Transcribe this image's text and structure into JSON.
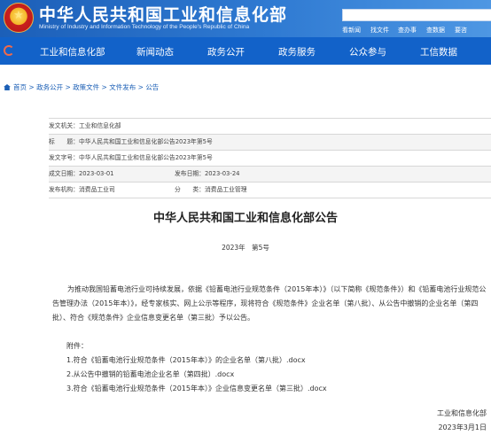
{
  "header": {
    "title": "中华人民共和国工业和信息化部",
    "subtitle": "Ministry of Industry and Information Technology of the People's Republic of China",
    "search_placeholder": "",
    "quick_links": [
      "看新闻",
      "找文件",
      "查办事",
      "查数据",
      "要咨"
    ]
  },
  "nav": {
    "items": [
      "工业和信息化部",
      "新闻动态",
      "政务公开",
      "政务服务",
      "公众参与",
      "工信数据"
    ]
  },
  "breadcrumb": {
    "items": [
      "首页",
      "政务公开",
      "政策文件",
      "文件发布",
      "公告"
    ],
    "separator": ">"
  },
  "meta": {
    "issuer_label": "发文机关：",
    "issuer": "工业和信息化部",
    "title_label": "标　　题：",
    "title": "中华人民共和国工业和信息化部公告2023年第5号",
    "doc_no_label": "发文字号：",
    "doc_no": "中华人民共和国工业和信息化部公告2023年第5号",
    "written_label": "成文日期：",
    "written_date": "2023-03-01",
    "published_label": "发布日期：",
    "published_date": "2023-03-24",
    "org_label": "发布机构：",
    "org": "消费品工业司",
    "category_label": "分　　类：",
    "category": "消费品工业管理"
  },
  "document": {
    "title": "中华人民共和国工业和信息化部公告",
    "number": "2023年　第5号",
    "paragraph": "为推动我国铅蓄电池行业可持续发展，依据《铅蓄电池行业规范条件（2015年本）》（以下简称《规范条件》）和《铅蓄电池行业规范公告管理办法（2015年本）》，经专家核实、网上公示等程序，现将符合《规范条件》企业名单（第八批）、从公告中撤销的企业名单（第四批）、符合《规范条件》企业信息变更名单（第三批）予以公告。",
    "attachments_label": "附件：",
    "attachments": [
      "1.符合《铅蓄电池行业规范条件（2015年本）》的企业名单（第八批）.docx",
      "2.从公告中撤销的铅蓄电池企业名单（第四批）.docx",
      "3.符合《铅蓄电池行业规范条件（2015年本）》企业信息变更名单（第三批）.docx"
    ],
    "signature": "工业和信息化部",
    "date": "2023年3月1日"
  }
}
